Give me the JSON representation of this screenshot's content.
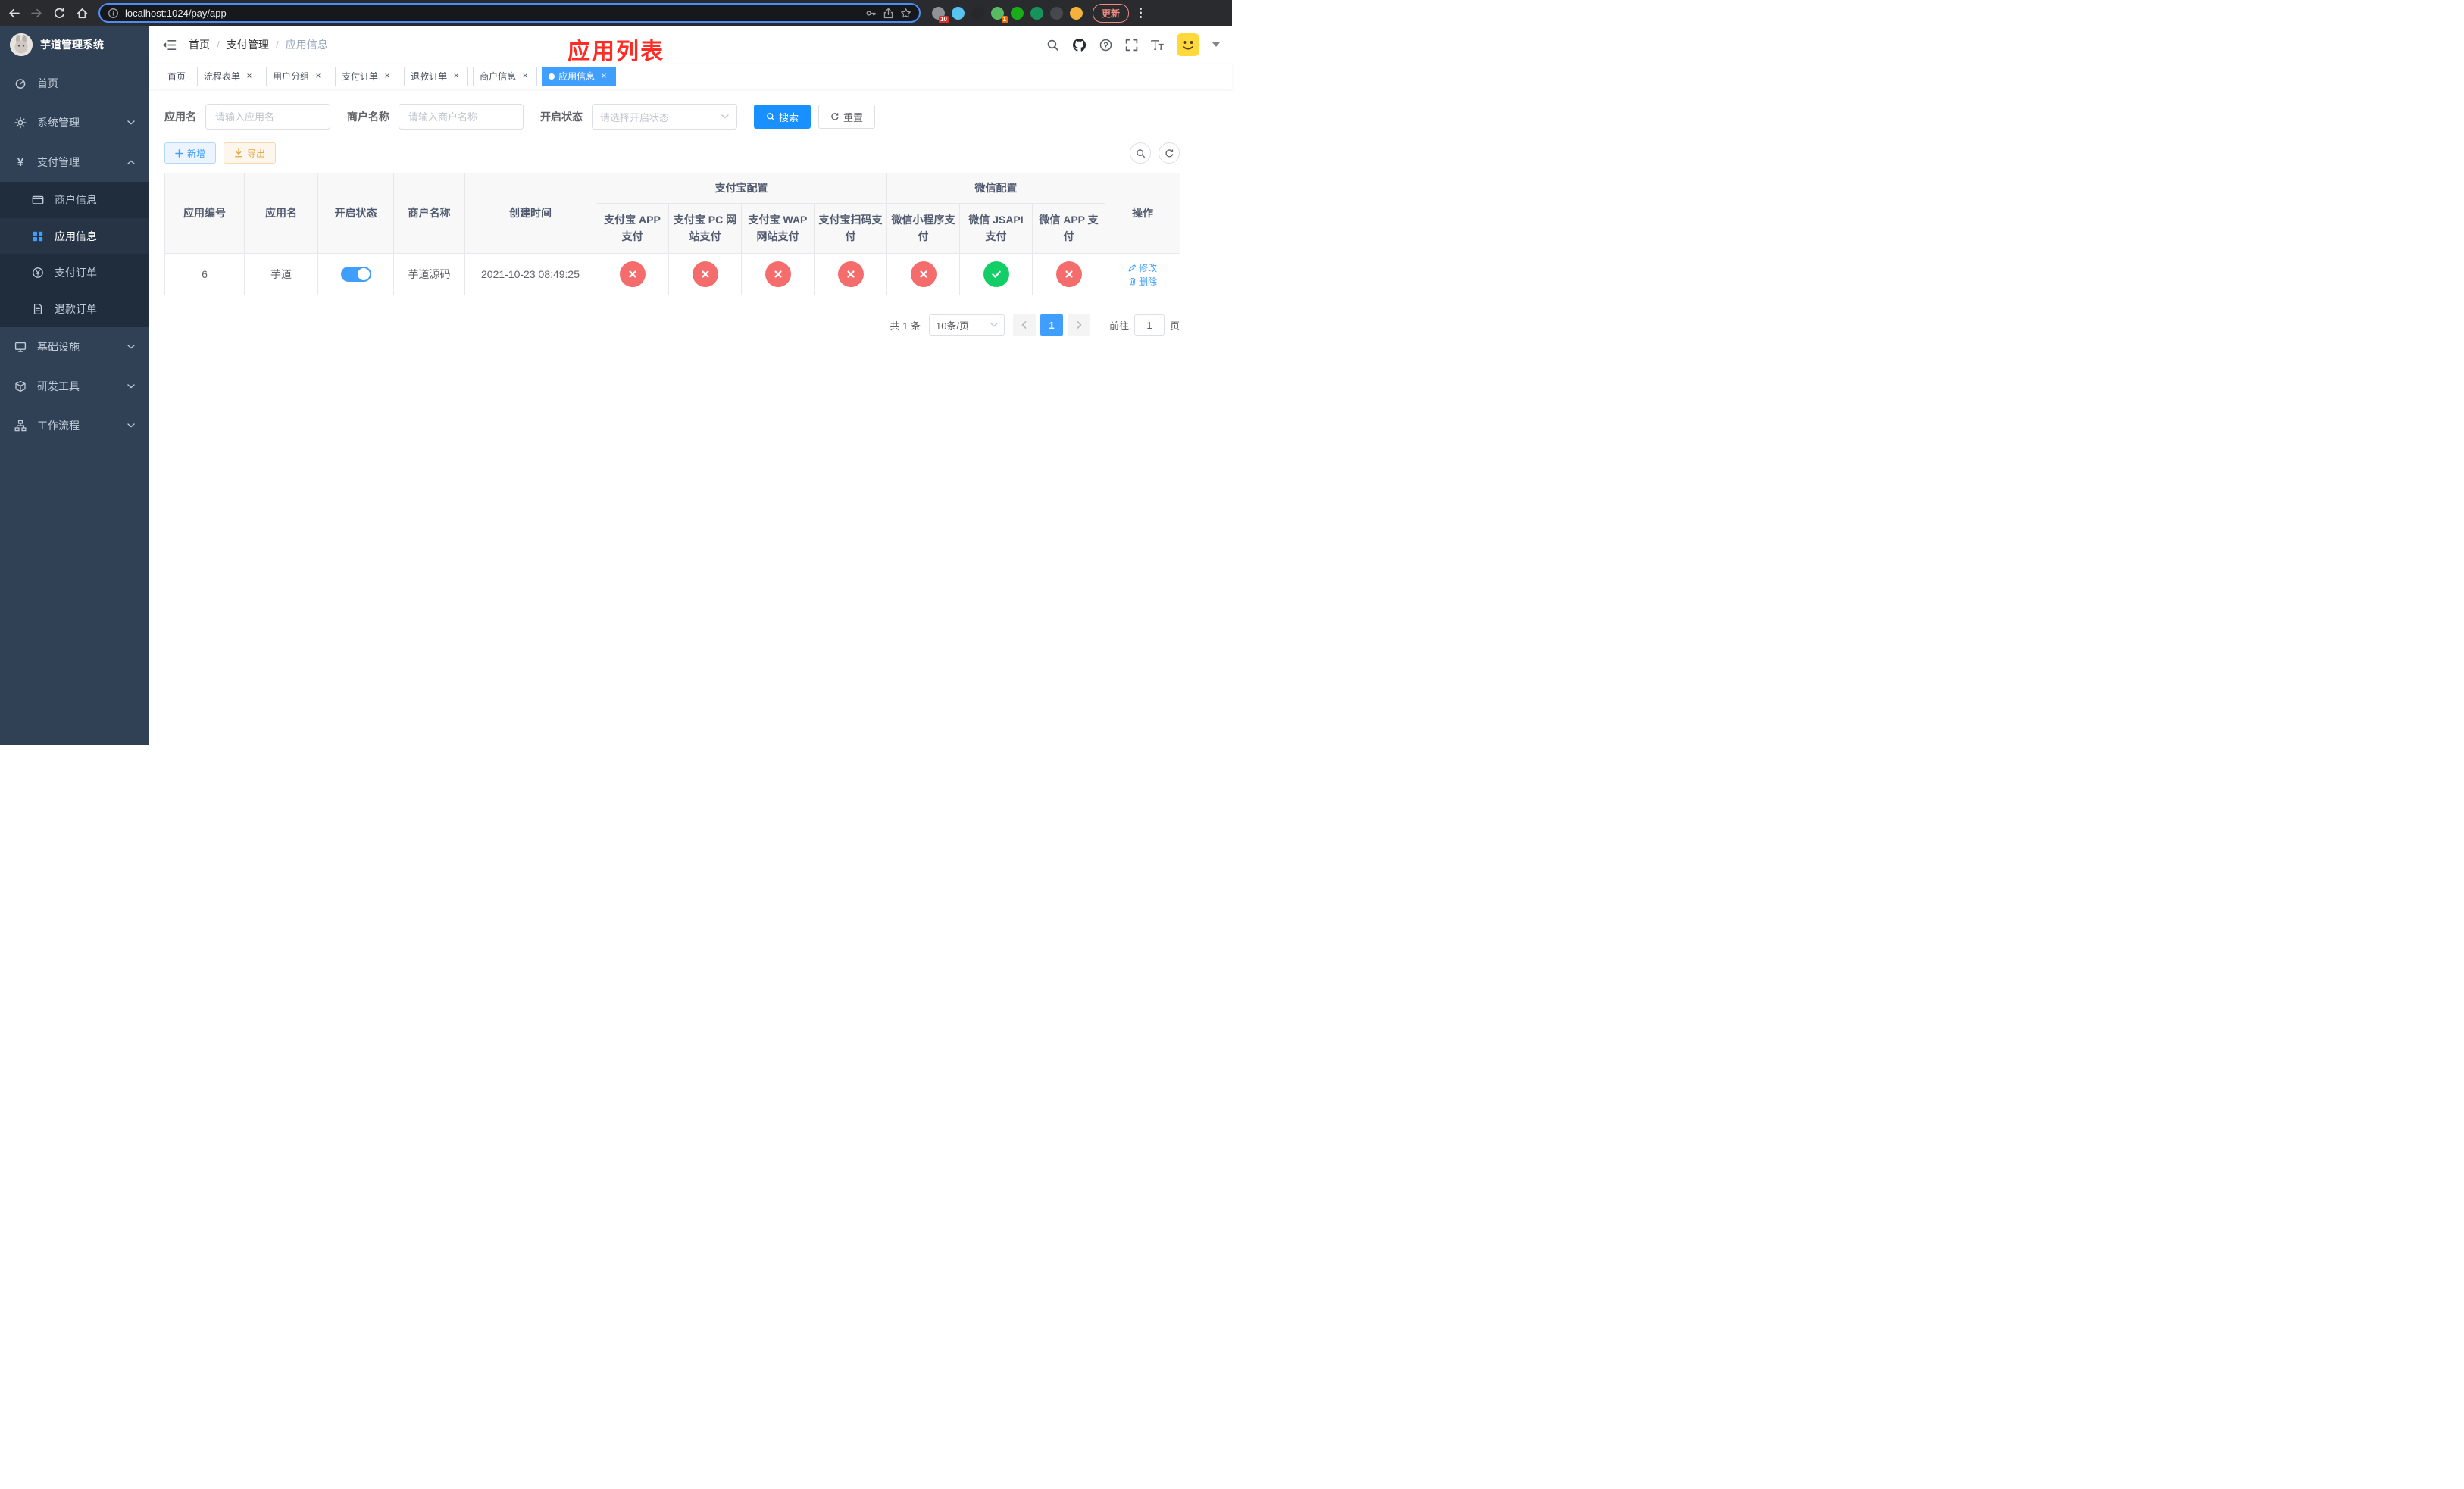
{
  "colors": {
    "accent": "#409eff",
    "success": "#13ce66",
    "danger": "#f56c6c",
    "warning": "#e6a23c",
    "search-blue": "#1890ff",
    "sidebar-bg": "#304156",
    "sidebar-sub-bg": "#1f2d3d",
    "overlay-red": "#fe2c24"
  },
  "browser": {
    "url": "localhost:1024/pay/app",
    "update_label": "更新",
    "extensions": [
      {
        "name": "puzzle-extension",
        "color": "#8f9398",
        "badge": "10",
        "badge_color": "#d93025"
      },
      {
        "name": "blue-drop-extension",
        "color": "#58c2f0"
      },
      {
        "name": "dark-globe-extension",
        "color": "#27282b"
      },
      {
        "name": "green-circle-extension",
        "color": "#57bb63",
        "badge": "1",
        "badge_color": "#e8710a"
      },
      {
        "name": "wechat-devtools-extension",
        "color": "#1aad19"
      },
      {
        "name": "green-book-extension",
        "color": "#17935c"
      },
      {
        "name": "dark-pin-extension",
        "color": "#45484d"
      },
      {
        "name": "yellow-face-extension",
        "color": "#f4b23c"
      }
    ]
  },
  "sidebar": {
    "title": "芋道管理系统",
    "items": [
      {
        "label": "首页"
      },
      {
        "label": "系统管理",
        "expanded": false
      },
      {
        "label": "支付管理",
        "expanded": true,
        "children": [
          {
            "label": "商户信息",
            "active": false
          },
          {
            "label": "应用信息",
            "active": true
          },
          {
            "label": "支付订单",
            "active": false
          },
          {
            "label": "退款订单",
            "active": false
          }
        ]
      },
      {
        "label": "基础设施",
        "expanded": false
      },
      {
        "label": "研发工具",
        "expanded": false
      },
      {
        "label": "工作流程",
        "expanded": false
      }
    ]
  },
  "header": {
    "breadcrumb": [
      "首页",
      "支付管理",
      "应用信息"
    ],
    "separator": "/",
    "overlay_title": "应用列表"
  },
  "tabs": [
    {
      "label": "首页",
      "closable": false,
      "active": false
    },
    {
      "label": "流程表单",
      "closable": true,
      "active": false
    },
    {
      "label": "用户分组",
      "closable": true,
      "active": false
    },
    {
      "label": "支付订单",
      "closable": true,
      "active": false
    },
    {
      "label": "退款订单",
      "closable": true,
      "active": false
    },
    {
      "label": "商户信息",
      "closable": true,
      "active": false
    },
    {
      "label": "应用信息",
      "closable": true,
      "active": true
    }
  ],
  "filters": {
    "app_name": {
      "label": "应用名",
      "placeholder": "请输入应用名"
    },
    "merchant": {
      "label": "商户名称",
      "placeholder": "请输入商户名称"
    },
    "status": {
      "label": "开启状态",
      "placeholder": "请选择开启状态"
    },
    "search_button": "搜索",
    "reset_button": "重置"
  },
  "toolbar": {
    "add_button": "新增",
    "export_button": "导出"
  },
  "table": {
    "simple_columns": [
      "应用编号",
      "应用名",
      "开启状态",
      "商户名称",
      "创建时间"
    ],
    "groups": [
      {
        "label": "支付宝配置",
        "columns": [
          "支付宝 APP 支付",
          "支付宝 PC 网站支付",
          "支付宝 WAP 网站支付",
          "支付宝扫码支付"
        ]
      },
      {
        "label": "微信配置",
        "columns": [
          "微信小程序支付",
          "微信 JSAPI 支付",
          "微信 APP 支付"
        ]
      }
    ],
    "action_column": "操作",
    "rows": [
      {
        "id": "6",
        "name": "芋道",
        "enabled": true,
        "merchant": "芋道源码",
        "created": "2021-10-23 08:49:25",
        "pay_status": [
          "no",
          "no",
          "no",
          "no",
          "no",
          "yes",
          "no"
        ],
        "actions": [
          "修改",
          "删除"
        ]
      }
    ]
  },
  "pagination": {
    "total": "共 1 条",
    "page_size": "10条/页",
    "current_page": "1",
    "goto_prefix": "前往",
    "goto_value": "1",
    "goto_suffix": "页"
  }
}
